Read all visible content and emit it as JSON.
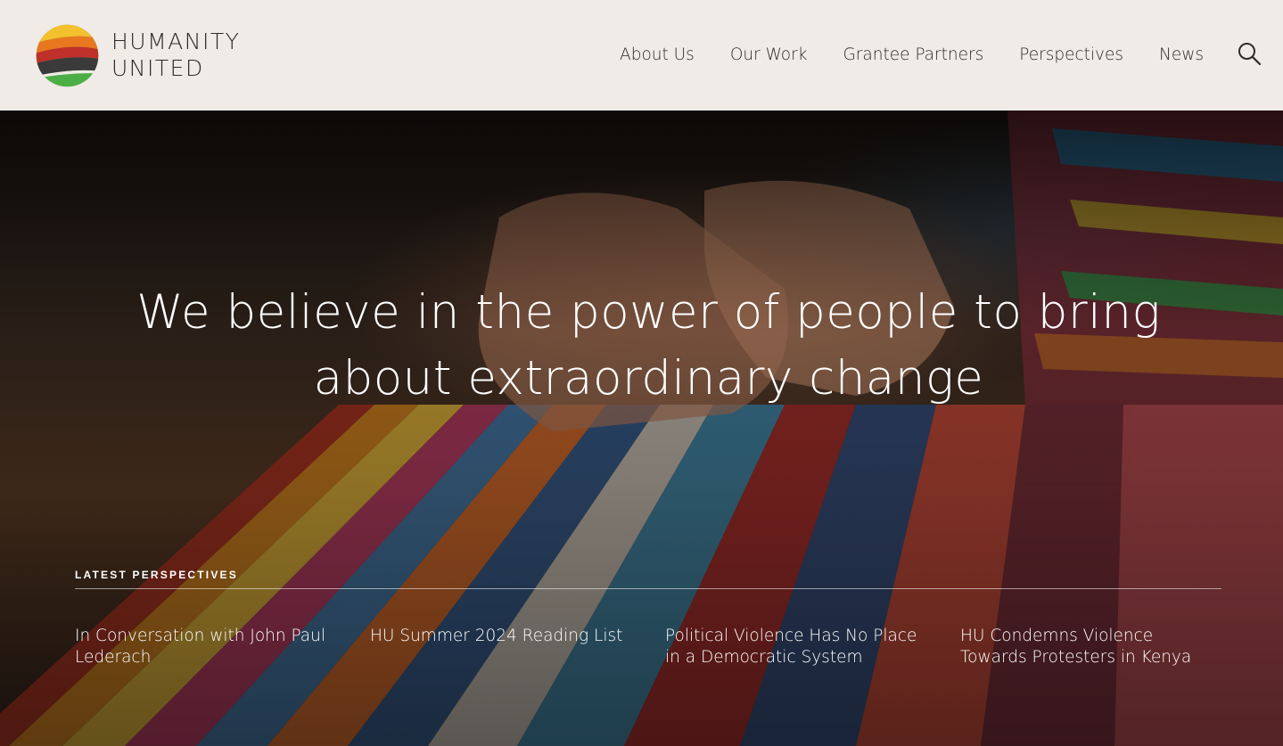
{
  "brand": {
    "line1": "HUMANITY",
    "line2": "UNITED",
    "colors": [
      "#f3c12e",
      "#e8771f",
      "#c0302a",
      "#3a3a3a",
      "#4caf46"
    ]
  },
  "nav": {
    "items": [
      "About Us",
      "Our Work",
      "Grantee Partners",
      "Perspectives",
      "News"
    ],
    "search_icon": "search-icon"
  },
  "hero": {
    "headline": "We believe in the power of people to bring about extraordinary change"
  },
  "latest": {
    "label": "LATEST PERSPECTIVES",
    "articles": [
      "In Conversation with John Paul Lederach",
      "HU Summer 2024 Reading List",
      "Political Violence Has No Place in a Democratic System",
      "HU Condemns Violence Towards Protesters in Kenya"
    ]
  },
  "colors": {
    "header_bg": "#f0ebe6",
    "text_dark": "#2b2b2b",
    "text_light": "#ffffff"
  }
}
